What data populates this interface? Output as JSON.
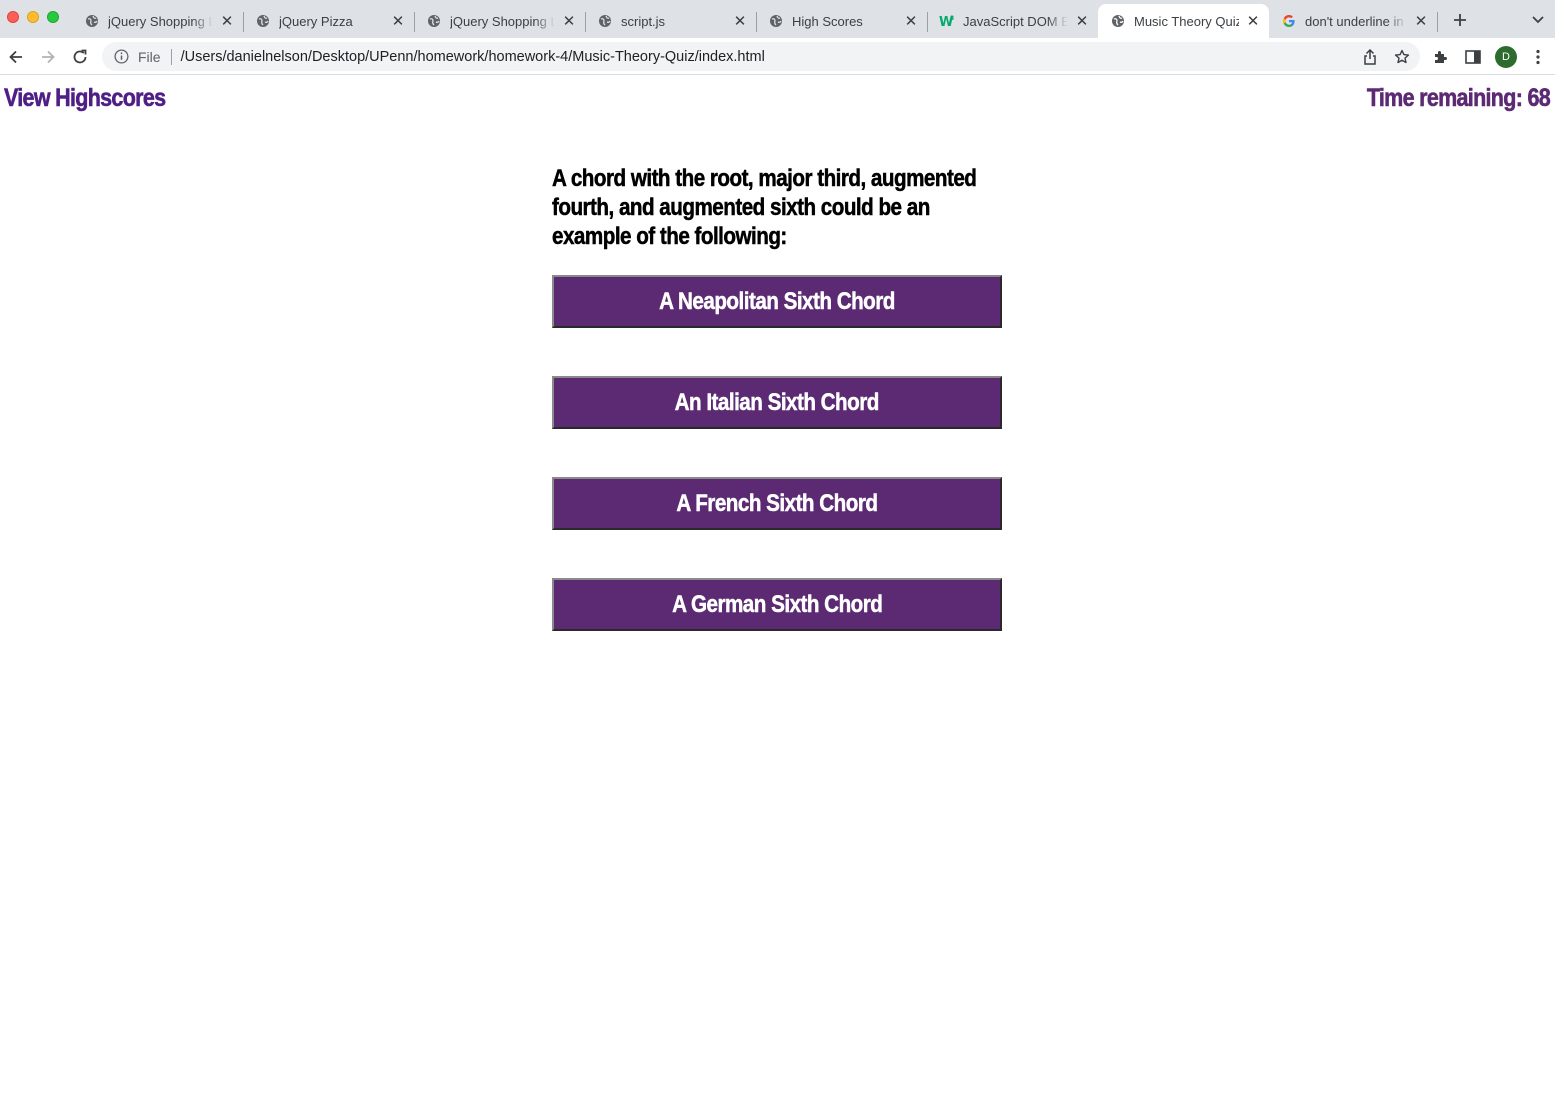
{
  "browser": {
    "tabs": [
      {
        "title": "jQuery Shopping List",
        "icon": "globe-icon",
        "active": false
      },
      {
        "title": "jQuery Pizza",
        "icon": "globe-icon",
        "active": false
      },
      {
        "title": "jQuery Shopping List",
        "icon": "globe-icon",
        "active": false
      },
      {
        "title": "script.js",
        "icon": "globe-icon",
        "active": false
      },
      {
        "title": "High Scores",
        "icon": "globe-icon",
        "active": false
      },
      {
        "title": "JavaScript DOM Elements",
        "icon": "w3schools-icon",
        "active": false
      },
      {
        "title": "Music Theory Quiz",
        "icon": "globe-icon",
        "active": true
      },
      {
        "title": "don't underline in css",
        "icon": "google-icon",
        "active": false
      }
    ],
    "address": {
      "scheme_label": "File",
      "url": "/Users/danielnelson/Desktop/UPenn/homework/homework-4/Music-Theory-Quiz/index.html"
    },
    "profile_initial": "D"
  },
  "page": {
    "view_highscores_label": "View Highscores",
    "timer_text": "Time remaining: 68",
    "question": "A chord with the root, major third, augmented fourth, and augmented sixth could be an example of the following:",
    "answers": [
      "A Neapolitan Sixth Chord",
      "An Italian Sixth Chord",
      "A French Sixth Chord",
      "A German Sixth Chord"
    ]
  },
  "colors": {
    "accent_purple": "#5b2a73",
    "link_purple": "#4f1f86",
    "tabbar_bg": "#dee1e6"
  }
}
